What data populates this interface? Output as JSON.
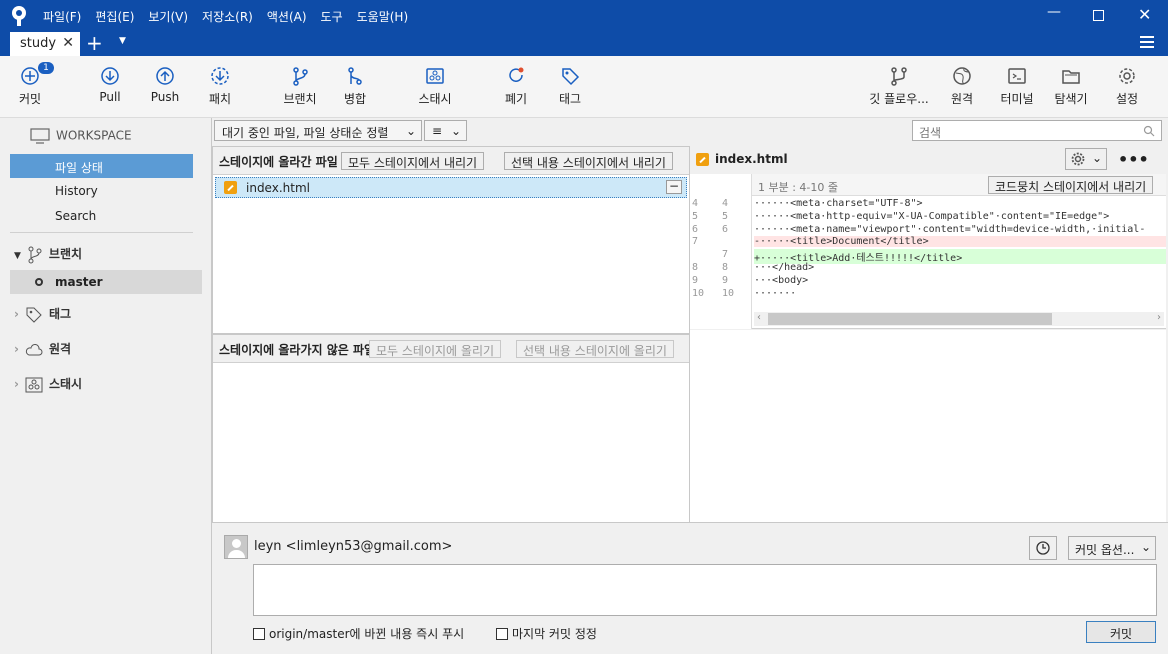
{
  "window": {
    "menu": [
      "파일(F)",
      "편집(E)",
      "보기(V)",
      "저장소(R)",
      "액션(A)",
      "도구",
      "도움말(H)"
    ],
    "tab_label": "study"
  },
  "toolbar": {
    "commit": "커밋",
    "commit_badge": "1",
    "pull": "Pull",
    "push": "Push",
    "fetch": "패치",
    "branch": "브랜치",
    "merge": "병합",
    "stash": "스태시",
    "discard": "폐기",
    "tag": "태그",
    "gitflow": "깃 플로우...",
    "remote": "원격",
    "terminal": "터미널",
    "explorer": "탐색기",
    "settings": "설정"
  },
  "sidebar": {
    "workspace": "WORKSPACE",
    "items": [
      "파일 상태",
      "History",
      "Search"
    ],
    "branches": "브랜치",
    "current_branch": "master",
    "tags": "태그",
    "remotes": "원격",
    "stashes": "스태시"
  },
  "filter": {
    "sort": "대기 중인 파일, 파일 상태순 정렬",
    "view": "≡",
    "search_placeholder": "검색"
  },
  "staged": {
    "title": "스테이지에 올라간 파일",
    "unstage_all": "모두 스테이지에서 내리기",
    "unstage_selected": "선택 내용 스테이지에서 내리기",
    "files": [
      {
        "name": "index.html"
      }
    ]
  },
  "unstaged": {
    "title": "스테이지에 올라가지 않은 파일",
    "stage_all": "모두 스테이지에 올리기",
    "stage_selected": "선택 내용 스테이지에 올리기"
  },
  "diff": {
    "file": "index.html",
    "hunk": "1 부분 : 4-10 줄",
    "unstage_hunk": "코드뭉치 스테이지에서 내리기",
    "lines": [
      {
        "old": "4",
        "new": "4",
        "type": "ctx",
        "text": "······<meta·charset=\"UTF-8\">"
      },
      {
        "old": "5",
        "new": "5",
        "type": "ctx",
        "text": "······<meta·http-equiv=\"X-UA-Compatible\"·content=\"IE=edge\">"
      },
      {
        "old": "6",
        "new": "6",
        "type": "ctx",
        "text": "······<meta·name=\"viewport\"·content=\"width=device-width,·initial-"
      },
      {
        "old": "7",
        "new": "",
        "type": "del",
        "text": "-·····<title>Document</title>"
      },
      {
        "old": "",
        "new": "7",
        "type": "add",
        "text": "+·····<title>Add·테스트!!!!!</title>"
      },
      {
        "old": "8",
        "new": "8",
        "type": "ctx",
        "text": "···</head>"
      },
      {
        "old": "9",
        "new": "9",
        "type": "ctx",
        "text": "···<body>"
      },
      {
        "old": "10",
        "new": "10",
        "type": "ctx",
        "text": "·······"
      }
    ]
  },
  "commit": {
    "author": "leyn <limleyn53@gmail.com>",
    "options": "커밋 옵션...",
    "push_immediately": "origin/master에 바뀐 내용 즉시 푸시",
    "amend": "마지막 커밋 정정",
    "commit_button": "커밋"
  }
}
